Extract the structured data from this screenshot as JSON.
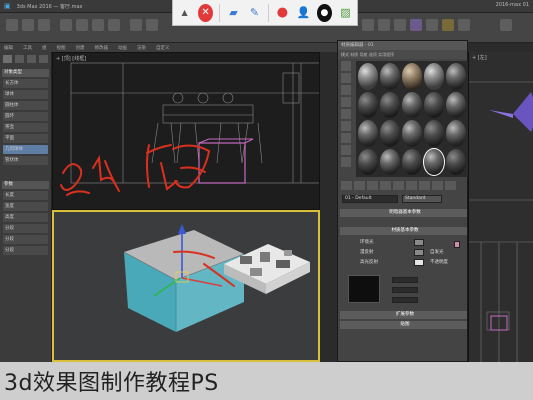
{
  "titlebar": {
    "left_text": "3ds Max 2016 — 客厅.max",
    "right_text": "2016-max 01"
  },
  "capture_toolbar": {
    "buttons": [
      "close",
      "eraser",
      "pen",
      "record",
      "user",
      "circle",
      "image"
    ]
  },
  "menu": [
    "编辑",
    "工具",
    "组",
    "视图",
    "创建",
    "修改器",
    "动画",
    "渲染",
    "自定义"
  ],
  "left_panel": {
    "header1": "对象类型",
    "items": [
      "长方体",
      "球体",
      "圆柱体",
      "圆环",
      "茶壶",
      "平面",
      "几何球体",
      "管状体"
    ],
    "selected_index": 6,
    "header2": "参数",
    "params": [
      "长度",
      "宽度",
      "高度",
      "分段",
      "分段",
      "分段"
    ]
  },
  "viewports": {
    "top_label": "+ [顶] [线框]",
    "persp_label": "透视",
    "persp_floating_text": "小平",
    "right_label": "+ [左]"
  },
  "material_editor": {
    "title": "材质编辑器 - 01",
    "menu_text": "模式  材质  导航  选项  实用程序",
    "material_name": "01 - Default",
    "material_type": "Standard",
    "section1": "明暗器基本参数",
    "section2": "材质基本参数",
    "rows": [
      "环境光",
      "漫反射",
      "高光反射",
      "自发光",
      "不透明度"
    ],
    "section3": "扩展参数",
    "section4": "贴图"
  },
  "caption": "3d效果图制作教程PS",
  "colors": {
    "handwriting": "#d9301f",
    "pink_object": "#c86ac4",
    "viewport_border": "#d8c03a",
    "gizmo_blue": "#3a58d8"
  }
}
